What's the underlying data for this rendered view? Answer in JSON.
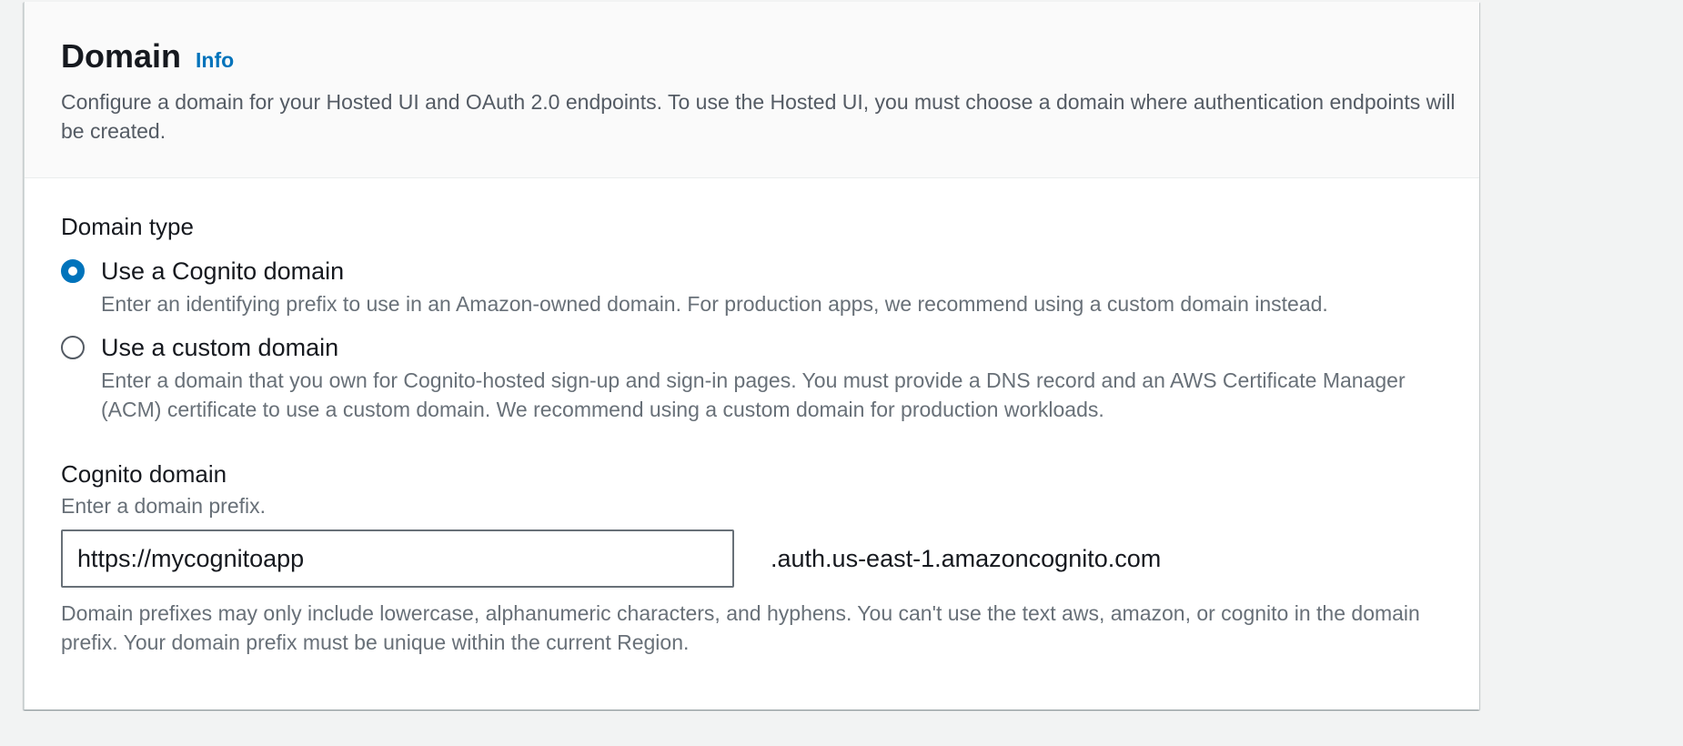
{
  "header": {
    "title": "Domain",
    "info_link": "Info",
    "description": "Configure a domain for your Hosted UI and OAuth 2.0 endpoints. To use the Hosted UI, you must choose a domain where authentication endpoints will be created."
  },
  "domain_type": {
    "label": "Domain type",
    "options": [
      {
        "label": "Use a Cognito domain",
        "description": "Enter an identifying prefix to use in an Amazon-owned domain. For production apps, we recommend using a custom domain instead.",
        "selected": true
      },
      {
        "label": "Use a custom domain",
        "description": "Enter a domain that you own for Cognito-hosted sign-up and sign-in pages. You must provide a DNS record and an AWS Certificate Manager (ACM) certificate to use a custom domain. We recommend using a custom domain for production workloads.",
        "selected": false
      }
    ]
  },
  "cognito_domain": {
    "label": "Cognito domain",
    "hint": "Enter a domain prefix.",
    "value": "https://mycognitoapp",
    "suffix": ".auth.us-east-1.amazoncognito.com",
    "constraint": "Domain prefixes may only include lowercase, alphanumeric characters, and hyphens. You can't use the text aws, amazon, or cognito in the domain prefix. Your domain prefix must be unique within the current Region."
  },
  "colors": {
    "accent": "#0073bb",
    "page_background": "#f2f3f3",
    "header_background": "#fafafa",
    "secondary_text": "#687078"
  }
}
